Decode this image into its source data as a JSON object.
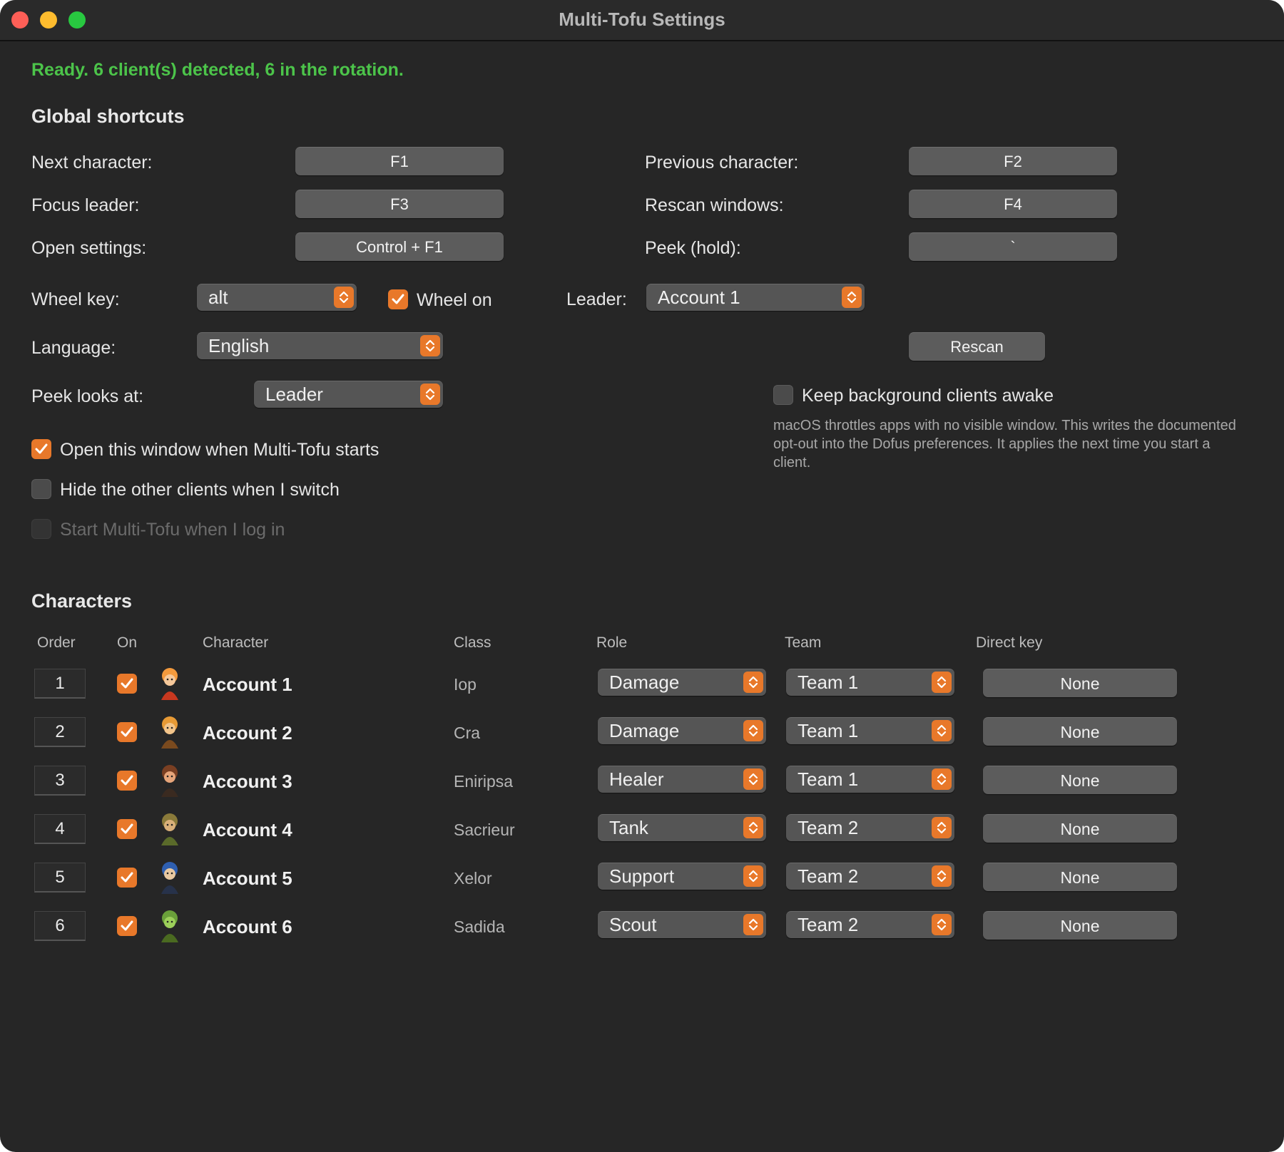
{
  "window": {
    "title": "Multi-Tofu Settings"
  },
  "status": "Ready. 6 client(s) detected, 6 in the rotation.",
  "global_shortcuts": {
    "title": "Global shortcuts",
    "next_label": "Next character:",
    "next_key": "F1",
    "previous_label": "Previous character:",
    "previous_key": "F2",
    "focus_label": "Focus leader:",
    "focus_key": "F3",
    "rescan_label": "Rescan windows:",
    "rescan_key": "F4",
    "open_label": "Open settings:",
    "open_key": "Control + F1",
    "peek_label": "Peek (hold):",
    "peek_key": "`"
  },
  "options": {
    "wheel_key_label": "Wheel key:",
    "wheel_key_value": "alt",
    "wheel_on_label": "Wheel on",
    "wheel_on_checked": true,
    "leader_label": "Leader:",
    "leader_value": "Account 1",
    "language_label": "Language:",
    "language_value": "English",
    "rescan_button": "Rescan",
    "peek_looks_label": "Peek looks at:",
    "peek_looks_value": "Leader",
    "keep_awake_label": "Keep background clients awake",
    "keep_awake_checked": false,
    "keep_awake_help": "macOS throttles apps with no visible window. This writes the documented opt-out into the Dofus preferences. It applies the next time you start a client.",
    "open_on_start_label": "Open this window when Multi-Tofu starts",
    "open_on_start_checked": true,
    "hide_others_label": "Hide the other clients when I switch",
    "hide_others_checked": false,
    "start_login_label": "Start Multi-Tofu when I log in",
    "start_login_checked": false
  },
  "characters": {
    "title": "Characters",
    "headers": {
      "order": "Order",
      "on": "On",
      "character": "Character",
      "class": "Class",
      "role": "Role",
      "team": "Team",
      "direct_key": "Direct key"
    },
    "rows": [
      {
        "order": "1",
        "on": true,
        "name": "Account 1",
        "class": "Iop",
        "role": "Damage",
        "team": "Team 1",
        "direct_key": "None",
        "avatar": "iop-avatar-icon"
      },
      {
        "order": "2",
        "on": true,
        "name": "Account 2",
        "class": "Cra",
        "role": "Damage",
        "team": "Team 1",
        "direct_key": "None",
        "avatar": "cra-avatar-icon"
      },
      {
        "order": "3",
        "on": true,
        "name": "Account 3",
        "class": "Eniripsa",
        "role": "Healer",
        "team": "Team 1",
        "direct_key": "None",
        "avatar": "eniripsa-avatar-icon"
      },
      {
        "order": "4",
        "on": true,
        "name": "Account 4",
        "class": "Sacrieur",
        "role": "Tank",
        "team": "Team 2",
        "direct_key": "None",
        "avatar": "sacrieur-avatar-icon"
      },
      {
        "order": "5",
        "on": true,
        "name": "Account 5",
        "class": "Xelor",
        "role": "Support",
        "team": "Team 2",
        "direct_key": "None",
        "avatar": "xelor-avatar-icon"
      },
      {
        "order": "6",
        "on": true,
        "name": "Account 6",
        "class": "Sadida",
        "role": "Scout",
        "team": "Team 2",
        "direct_key": "None",
        "avatar": "sadida-avatar-icon"
      }
    ]
  },
  "colors": {
    "accent": "#e8782a",
    "status_green": "#4cc44a",
    "background": "#262626"
  }
}
